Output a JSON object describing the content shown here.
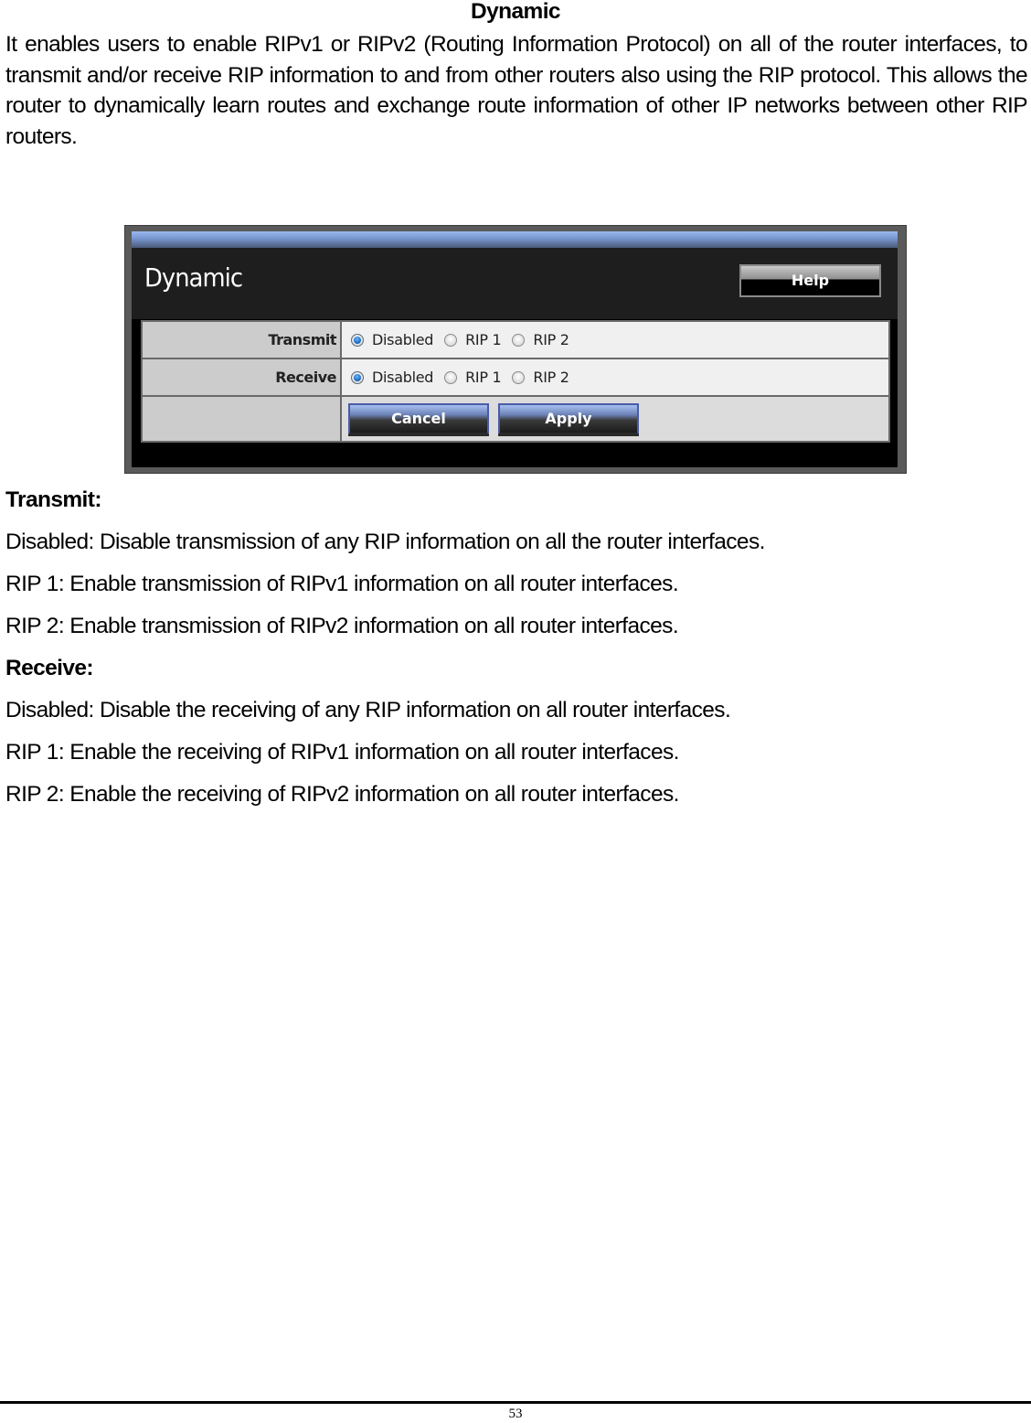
{
  "document": {
    "section_title": "Dynamic",
    "intro": "It enables users to enable RIPv1 or RIPv2 (Routing Information Protocol) on all of the router interfaces, to transmit and/or receive RIP information to and from other routers also using the RIP protocol. This allows the router to dynamically learn routes and exchange route information of other IP networks between other RIP routers.",
    "transmit": {
      "heading": "Transmit:",
      "lines": [
        "Disabled: Disable transmission of any RIP information on all the router interfaces.",
        "RIP 1: Enable transmission of RIPv1 information on all router interfaces.",
        "RIP 2: Enable transmission of RIPv2 information on all router interfaces."
      ]
    },
    "receive": {
      "heading": "Receive:",
      "lines": [
        "Disabled: Disable the receiving of any RIP information on all router interfaces.",
        "RIP 1: Enable the receiving of RIPv1 information on all router interfaces.",
        "RIP 2: Enable the receiving of RIPv2 information on all router interfaces."
      ]
    },
    "page_number": "53"
  },
  "screenshot": {
    "title": "Dynamic",
    "help_label": "Help",
    "rows": [
      {
        "label": "Transmit",
        "options": [
          "Disabled",
          "RIP 1",
          "RIP 2"
        ],
        "selected": "Disabled"
      },
      {
        "label": "Receive",
        "options": [
          "Disabled",
          "RIP 1",
          "RIP 2"
        ],
        "selected": "Disabled"
      }
    ],
    "cancel_label": "Cancel",
    "apply_label": "Apply"
  }
}
